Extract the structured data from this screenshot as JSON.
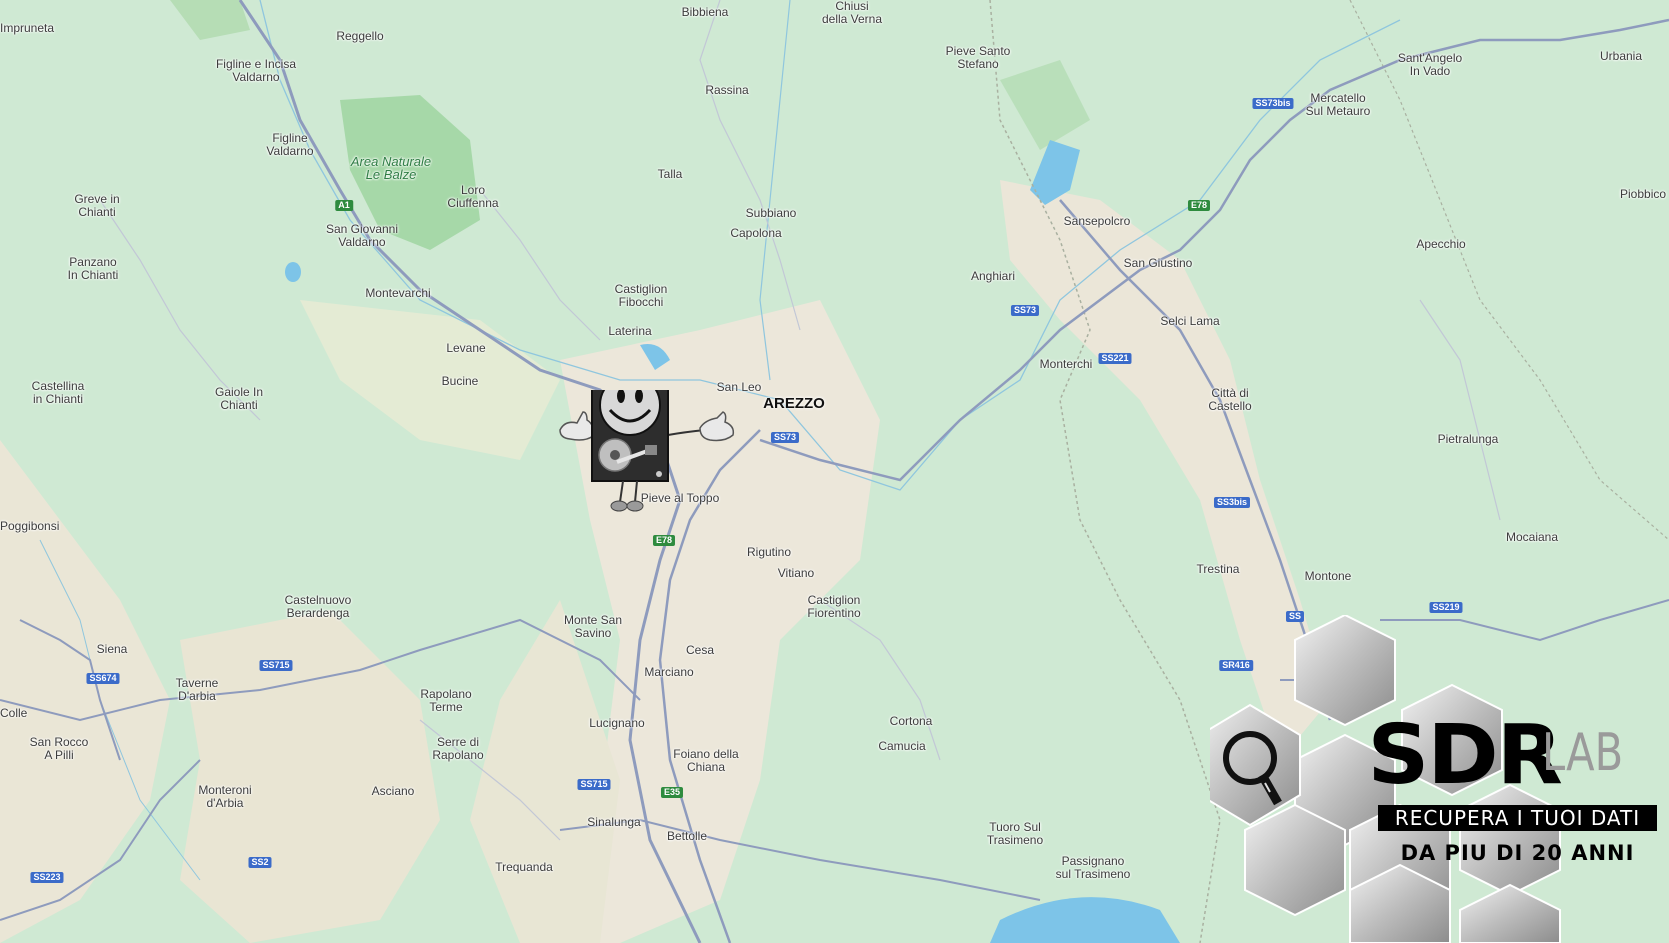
{
  "map": {
    "places": [
      {
        "name": "Impruneta",
        "kind": "town",
        "edge": true
      },
      {
        "name": "Reggello",
        "kind": "town"
      },
      {
        "name": "Bibbiena",
        "kind": "town"
      },
      {
        "name": "Chiusi\ndella Verna",
        "kind": "town"
      },
      {
        "name": "Pieve Santo\nStefano",
        "kind": "town"
      },
      {
        "name": "Sant'Angelo\nIn Vado",
        "kind": "town"
      },
      {
        "name": "Urbania",
        "kind": "town",
        "edge": true
      },
      {
        "name": "Figline e Incisa\nValdarno",
        "kind": "town"
      },
      {
        "name": "Rassina",
        "kind": "town"
      },
      {
        "name": "Mercatello\nSul Metauro",
        "kind": "town"
      },
      {
        "name": "Figline\nValdarno",
        "kind": "town"
      },
      {
        "name": "Area Naturale\nLe Balze",
        "kind": "park"
      },
      {
        "name": "Talla",
        "kind": "town"
      },
      {
        "name": "Loro\nCiuffenna",
        "kind": "town"
      },
      {
        "name": "Greve in\nChianti",
        "kind": "town"
      },
      {
        "name": "Subbiano",
        "kind": "town"
      },
      {
        "name": "Sansepolcro",
        "kind": "town"
      },
      {
        "name": "Piobbico",
        "kind": "town",
        "edge": true
      },
      {
        "name": "San Giovanni\nValdarno",
        "kind": "town"
      },
      {
        "name": "Capolona",
        "kind": "town"
      },
      {
        "name": "Apecchio",
        "kind": "town"
      },
      {
        "name": "Panzano\nIn Chianti",
        "kind": "town"
      },
      {
        "name": "San Giustino",
        "kind": "town"
      },
      {
        "name": "Anghiari",
        "kind": "town"
      },
      {
        "name": "Castiglion\nFibocchi",
        "kind": "town"
      },
      {
        "name": "Montevarchi",
        "kind": "town"
      },
      {
        "name": "Selci Lama",
        "kind": "town"
      },
      {
        "name": "Laterina",
        "kind": "town"
      },
      {
        "name": "Levane",
        "kind": "town"
      },
      {
        "name": "Monterchi",
        "kind": "town"
      },
      {
        "name": "Bucine",
        "kind": "town"
      },
      {
        "name": "San Leo",
        "kind": "town"
      },
      {
        "name": "Castellina\nin Chianti",
        "kind": "town"
      },
      {
        "name": "Gaiole In\nChianti",
        "kind": "town"
      },
      {
        "name": "AREZZO",
        "kind": "city"
      },
      {
        "name": "Città di\nCastello",
        "kind": "town"
      },
      {
        "name": "Pietralunga",
        "kind": "town"
      },
      {
        "name": "Pieve al Toppo",
        "kind": "town"
      },
      {
        "name": "Poggibonsi",
        "kind": "town",
        "edge": true
      },
      {
        "name": "Mocaiana",
        "kind": "town"
      },
      {
        "name": "Rigutino",
        "kind": "town"
      },
      {
        "name": "Trestina",
        "kind": "town"
      },
      {
        "name": "Vitiano",
        "kind": "town"
      },
      {
        "name": "Montone",
        "kind": "town"
      },
      {
        "name": "Castelnuovo\nBerardenga",
        "kind": "town"
      },
      {
        "name": "Castiglion\nFiorentino",
        "kind": "town"
      },
      {
        "name": "Monte San\nSavino",
        "kind": "town"
      },
      {
        "name": "Siena",
        "kind": "town"
      },
      {
        "name": "Cesa",
        "kind": "town"
      },
      {
        "name": "Taverne\nD'arbia",
        "kind": "town"
      },
      {
        "name": "Marciano",
        "kind": "town"
      },
      {
        "name": "Rapolano\nTerme",
        "kind": "town"
      },
      {
        "name": "Colle",
        "kind": "town",
        "edge": true
      },
      {
        "name": "Lucignano",
        "kind": "town"
      },
      {
        "name": "Cortona",
        "kind": "town"
      },
      {
        "name": "Serre di\nRapolano",
        "kind": "town"
      },
      {
        "name": "San Rocco\nA Pilli",
        "kind": "town"
      },
      {
        "name": "Camucia",
        "kind": "town"
      },
      {
        "name": "Foiano della\nChiana",
        "kind": "town"
      },
      {
        "name": "Asciano",
        "kind": "town"
      },
      {
        "name": "Monteroni\nd'Arbia",
        "kind": "town"
      },
      {
        "name": "Sinalunga",
        "kind": "town"
      },
      {
        "name": "Tuoro Sul\nTrasimeno",
        "kind": "town"
      },
      {
        "name": "Bettolle",
        "kind": "town"
      },
      {
        "name": "Trequanda",
        "kind": "town"
      },
      {
        "name": "Passignano\nsul Trasimeno",
        "kind": "town"
      }
    ],
    "road_shields": [
      {
        "label": "SS73bis",
        "type": "ss"
      },
      {
        "label": "E78",
        "type": "e"
      },
      {
        "label": "A1",
        "type": "e"
      },
      {
        "label": "SS73",
        "type": "ss"
      },
      {
        "label": "SS221",
        "type": "ss"
      },
      {
        "label": "SS73",
        "type": "ss"
      },
      {
        "label": "SS3bis",
        "type": "ss"
      },
      {
        "label": "E78",
        "type": "e"
      },
      {
        "label": "SS219",
        "type": "ss"
      },
      {
        "label": "SS",
        "type": "ss"
      },
      {
        "label": "SS715",
        "type": "ss"
      },
      {
        "label": "SS674",
        "type": "ss"
      },
      {
        "label": "SR416",
        "type": "ss"
      },
      {
        "label": "SS715",
        "type": "ss"
      },
      {
        "label": "E35",
        "type": "e"
      },
      {
        "label": "SS2",
        "type": "ss"
      },
      {
        "label": "SS223",
        "type": "ss"
      }
    ],
    "colors": {
      "land": "#cfe9d3",
      "urban": "#efeadf",
      "water": "#7dc4e8",
      "road": "#9aa7c7",
      "park": "#a6d8a8"
    }
  },
  "logo": {
    "brand": "SDR",
    "lab": "LAB",
    "tagline": "RECUPERA I TUOI DATI",
    "tagline2": "DA  PIU DI 20 ANNI"
  },
  "mascot": {
    "icon": "smiley-hard-drive-mascot"
  }
}
